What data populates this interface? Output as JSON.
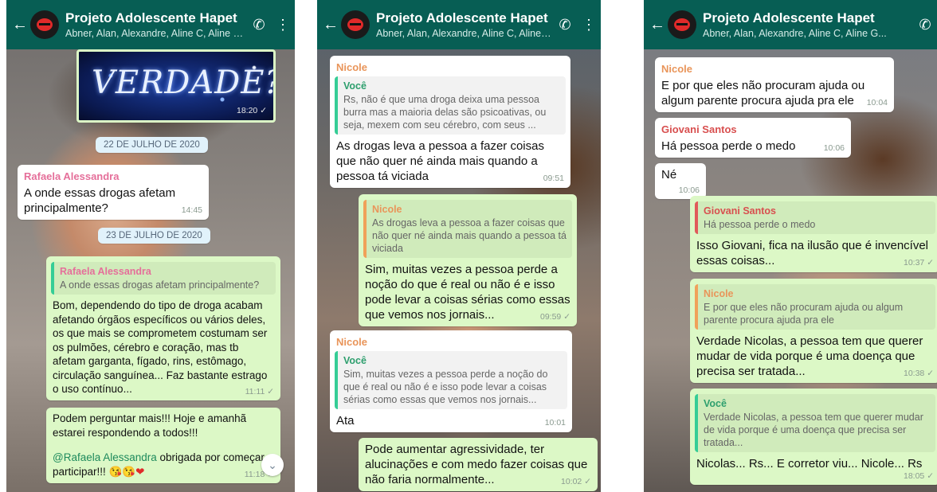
{
  "header": {
    "title": "Projeto Adolescente Hapet",
    "subtitle": "Abner, Alan, Alexandre, Aline C, Aline G..."
  },
  "icons": {
    "back": "arrow-left-icon",
    "call": "add-call-icon",
    "menu": "more-vert-icon",
    "scroll": "chevron-down-icon"
  },
  "colors": {
    "header": "#075e54",
    "incoming": "#ffffff",
    "outgoing": "#dcf8c6"
  },
  "panel1": {
    "image_text": "VERDADE?",
    "image_time": "18:20 ✓",
    "date1": "22 DE JULHO DE 2020",
    "msg1": {
      "sender": "Rafaela Alessandra",
      "text": "A onde essas drogas afetam principalmente?",
      "time": "14:45"
    },
    "date2": "23 DE JULHO DE 2020",
    "msg2": {
      "quote_name": "Rafaela Alessandra",
      "quote_text": "A onde essas drogas afetam principalmente?",
      "text": "Bom, dependendo do tipo de droga acabam afetando órgãos específicos ou vários deles, os que mais se comprometem costumam ser os pulmões, cérebro e coração, mas tb afetam garganta, fígado, rins, estômago, circulação sanguínea... Faz bastante estrago o uso contínuo...",
      "time": "11:11 ✓"
    },
    "msg3": {
      "text": "Podem perguntar mais!!! Hoje e amanhã estarei respondendo a todos!!!",
      "mention": "@Rafaela Alessandra",
      "text2": " obrigada por começar e participar!!! ",
      "emoji": "😘😘",
      "heart": "❤",
      "time": "11:18 ✓"
    }
  },
  "panel2": {
    "msg1": {
      "sender": "Nicole",
      "quote_name": "Você",
      "quote_text": "Rs, não é que uma droga deixa uma pessoa burra mas a maioria delas são psicoativas, ou seja, mexem com seu cérebro, com seus ...",
      "text": "As drogas leva a pessoa a fazer coisas que não quer né ainda mais quando a pessoa tá viciada",
      "time": "09:51"
    },
    "msg2": {
      "quote_name": "Nicole",
      "quote_text": "As drogas leva a pessoa a fazer coisas que não quer né ainda mais quando a pessoa tá viciada",
      "text": "Sim, muitas vezes a pessoa perde a noção do que é real ou não é e isso pode levar a coisas sérias como essas que vemos nos jornais...",
      "time": "09:59 ✓"
    },
    "msg3": {
      "sender": "Nicole",
      "quote_name": "Você",
      "quote_text": "Sim, muitas vezes a pessoa perde a noção do que é real ou não é e isso pode levar a coisas sérias como essas que vemos nos jornais...",
      "text": "Ata",
      "time": "10:01"
    },
    "msg4": {
      "text": "Pode aumentar agressividade, ter alucinações e com medo fazer coisas que não faria normalmente...",
      "time": "10:02 ✓"
    }
  },
  "panel3": {
    "msg1": {
      "sender": "Nicole",
      "text": "E por que eles não procuram ajuda ou algum parente procura ajuda pra ele",
      "time": "10:04"
    },
    "msg2": {
      "sender": "Giovani Santos",
      "text": "Há pessoa perde o medo",
      "time": "10:06"
    },
    "msg3": {
      "text": "Né",
      "time": "10:06"
    },
    "msg4": {
      "quote_name": "Giovani Santos",
      "quote_text": "Há pessoa perde o medo",
      "text": "Isso Giovani, fica na ilusão que é invencível essas coisas...",
      "time": "10:37 ✓"
    },
    "msg5": {
      "quote_name": "Nicole",
      "quote_text": "E por que eles não procuram ajuda ou algum parente procura ajuda pra ele",
      "text": "Verdade Nicolas, a pessoa tem que querer mudar de vida porque é uma doença que precisa ser tratada...",
      "time": "10:38 ✓"
    },
    "msg6": {
      "quote_name": "Você",
      "quote_text": "Verdade Nicolas, a pessoa tem que querer mudar de vida porque é uma doença que precisa ser tratada...",
      "text": "Nicolas... Rs... E corretor viu... Nicole... Rs",
      "time": "18:05 ✓"
    }
  }
}
